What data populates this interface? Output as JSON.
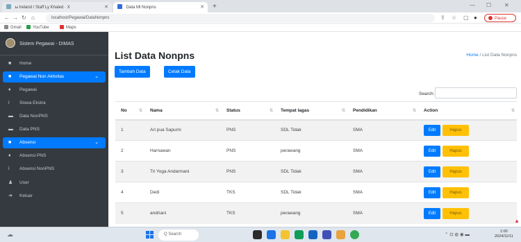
{
  "browser": {
    "tabs": [
      {
        "title": "ы Ireland / Staff Ly Khaled · X",
        "active": false
      },
      {
        "title": "Data Ml Nonpns",
        "active": true
      }
    ],
    "url": "localhost/Pegawai/DataNonpns",
    "profile_label": "Pause",
    "bookmarks": [
      "Gmail",
      "YouTube",
      "Maps"
    ]
  },
  "sidebar": {
    "brand": "Sistem Pegawai - DIMAS",
    "items": [
      {
        "label": "Home",
        "icon": "home-icon",
        "active": false
      },
      {
        "label": "Pegawai Non Aktivitas",
        "icon": "users-icon",
        "active": true
      },
      {
        "label": "Pegawai",
        "icon": "user-icon",
        "active": false
      },
      {
        "label": "Siswa Ekstra",
        "icon": "info-icon",
        "active": false
      },
      {
        "label": "Data NonPNS",
        "icon": "table-icon",
        "active": false
      },
      {
        "label": "Data PNS",
        "icon": "table-icon",
        "active": false
      },
      {
        "label": "Absensi",
        "icon": "folder-icon",
        "active": true
      },
      {
        "label": "Absensi PNS",
        "icon": "user-icon",
        "active": false
      },
      {
        "label": "Absensi NonPNS",
        "icon": "info-icon",
        "active": false
      },
      {
        "label": "User",
        "icon": "person-icon",
        "active": false
      },
      {
        "label": "Keluar",
        "icon": "logout-icon",
        "active": false
      }
    ]
  },
  "main": {
    "title": "List Data Nonpns",
    "breadcrumb_home": "Home",
    "breadcrumb_current": "List Data Nonpns",
    "add_button": "Tambah Data",
    "print_button": "Cetak Data",
    "search_label": "Search:",
    "table": {
      "headers": [
        "No",
        "Nama",
        "Status",
        "Tempat lagas",
        "Pendidikan",
        "Action"
      ],
      "rows": [
        [
          "1",
          "Ari pua Sapurni",
          "PNS",
          "SDL Tidak",
          "SMA"
        ],
        [
          "2",
          "Harnawan",
          "PNS",
          "perawang",
          "SMA"
        ],
        [
          "3",
          "Tri Yoga Andarmani",
          "PNS",
          "SDL Tidak",
          "SMA"
        ],
        [
          "4",
          "Dedi",
          "TKS",
          "SDL Tidak",
          "SMA"
        ],
        [
          "5",
          "andriani",
          "TKS",
          "perawang",
          "SMA"
        ]
      ],
      "edit_label": "Edit",
      "delete_label": "Hapus"
    }
  },
  "taskbar": {
    "search_placeholder": "Q Search",
    "clock_time": "1:00",
    "clock_date": "2024/11/11"
  }
}
